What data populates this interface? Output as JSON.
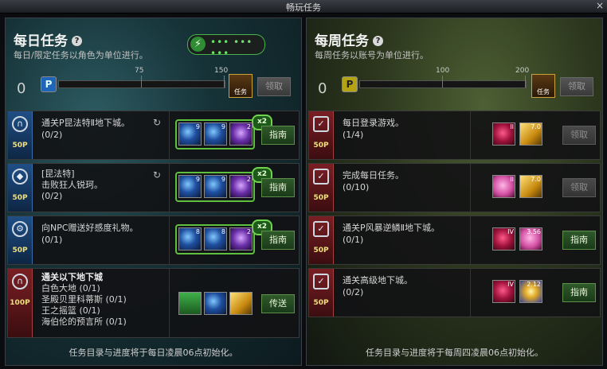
{
  "window": {
    "title": "畅玩任务",
    "close": "×"
  },
  "daily": {
    "title": "每日任务",
    "help": "?",
    "subtitle": "每日/限定任务以角色为单位进行。",
    "points_value": "0",
    "points_badge": "P",
    "ticks": [
      "75",
      "150"
    ],
    "chest_label": "任务",
    "claim_button": "领取",
    "energy_icon": "⚡",
    "energy_dots": "••• ••• •••",
    "footer": "任务目录与进度将于每日凌晨06点初始化。",
    "quests": [
      {
        "title": "通关P昆法特Ⅱ地下城。",
        "progress": "(0/2)",
        "points": "50P",
        "icon": "gate-icon",
        "icon_glyph": "∩",
        "multiplier": "x2",
        "button": "指南",
        "rewards": [
          {
            "count": "9"
          },
          {
            "count": "9"
          },
          {
            "count": "2"
          }
        ]
      },
      {
        "title": "[昆法特]",
        "line2": "击败狂人锐珂。",
        "progress": "(0/2)",
        "points": "50P",
        "icon": "crystal-icon",
        "icon_glyph": "◆",
        "multiplier": "x2",
        "button": "指南",
        "rewards": [
          {
            "count": "9"
          },
          {
            "count": "9"
          },
          {
            "count": "2"
          }
        ]
      },
      {
        "title": "向NPC赠送好感度礼物。",
        "progress": "(0/1)",
        "points": "50P",
        "icon": "gear-icon",
        "icon_glyph": "⚙",
        "multiplier": "x2",
        "button": "指南",
        "rewards": [
          {
            "count": "8"
          },
          {
            "count": "8"
          },
          {
            "count": "2"
          }
        ]
      },
      {
        "title": "通关以下地下城",
        "points": "100P",
        "icon": "gate-icon",
        "icon_glyph": "∩",
        "button": "传送",
        "dungeons": [
          "白色大地 (0/1)",
          "圣殿贝里科蒂斯 (0/1)",
          "王之摇篮 (0/1)",
          "海伯伦的预言所 (0/1)"
        ]
      }
    ]
  },
  "weekly": {
    "title": "每周任务",
    "help": "?",
    "subtitle": "每周任务以账号为单位进行。",
    "points_value": "0",
    "points_badge": "P",
    "ticks": [
      "100",
      "200"
    ],
    "chest_label": "任务",
    "claim_button": "领取",
    "footer": "任务目录与进度将于每周四凌晨06点初始化。",
    "quests": [
      {
        "title": "每日登录游戏。",
        "progress": "(1/4)",
        "points": "50P",
        "button": "领取",
        "enabled": false,
        "rewards": [
          {
            "count": "II"
          },
          {
            "count": "7.0"
          }
        ]
      },
      {
        "title": "完成每日任务。",
        "progress": "(0/10)",
        "points": "50P",
        "button": "领取",
        "enabled": false,
        "rewards": [
          {
            "count": "II"
          },
          {
            "count": "7.0"
          }
        ]
      },
      {
        "title": "通关P风暴逆鳞Ⅱ地下城。",
        "progress": "(0/1)",
        "points": "50P",
        "button": "指南",
        "enabled": true,
        "rewards": [
          {
            "count": "IV"
          },
          {
            "count": "3.56"
          }
        ]
      },
      {
        "title": "通关高级地下城。",
        "progress": "(0/2)",
        "points": "50P",
        "button": "指南",
        "enabled": true,
        "rewards": [
          {
            "count": "IV"
          },
          {
            "count": "2.12"
          }
        ]
      }
    ]
  },
  "colors": {
    "accent_green": "#5fbf3f",
    "points_yellow": "#f0e07a",
    "daily_tab": "#1f4f86",
    "weekly_tab": "#7a1f24"
  }
}
